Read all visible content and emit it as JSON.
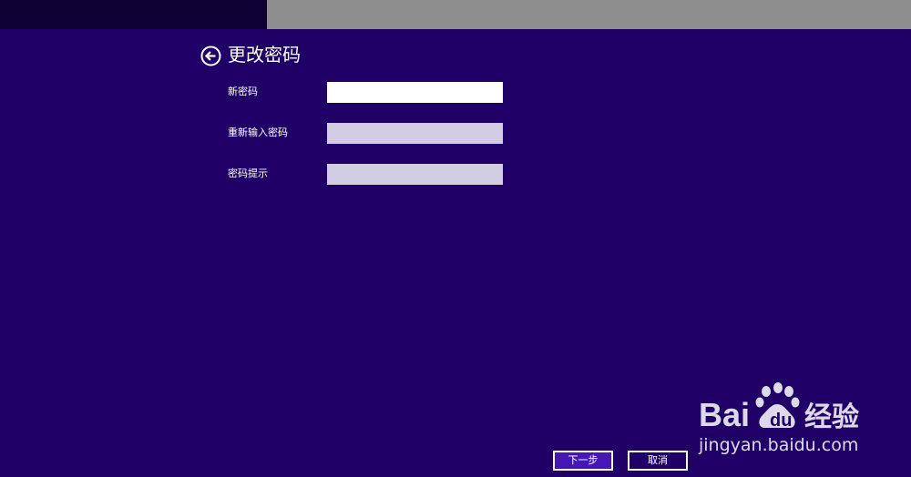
{
  "header": {
    "title": "更改密码",
    "back_icon": "back-arrow-circle-icon"
  },
  "form": {
    "fields": [
      {
        "label": "新密码",
        "value": "",
        "placeholder": ""
      },
      {
        "label": "重新输入密码",
        "value": "",
        "placeholder": ""
      },
      {
        "label": "密码提示",
        "value": "",
        "placeholder": ""
      }
    ]
  },
  "buttons": {
    "next_label": "下一步",
    "cancel_label": "取消"
  },
  "colors": {
    "background": "#200066",
    "topbar_dark": "#0d0033",
    "topbar_gray": "#8e8e8e",
    "input_active": "#ffffff",
    "input_inactive": "#d3cde4",
    "next_button": "#4617b4"
  },
  "watermark": {
    "brand": "Baidu经验",
    "url": "jingyan.baidu.com"
  }
}
